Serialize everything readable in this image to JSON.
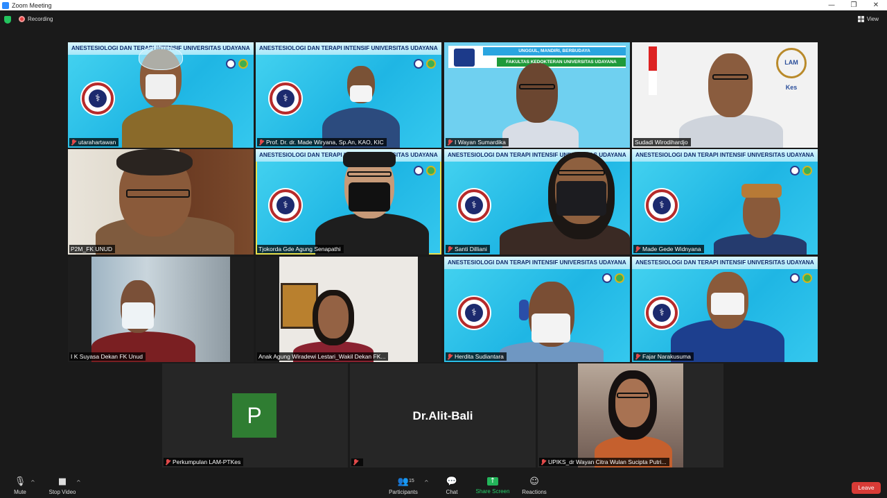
{
  "window": {
    "title": "Zoom Meeting",
    "minimize": "—",
    "restore": "❐",
    "close": "✕"
  },
  "topbar": {
    "recording": "Recording",
    "view": "View"
  },
  "banner_text": "ANESTESIOLOGI DAN TERAPI INTENSIF UNIVERSITAS UDAYANA",
  "slide3": {
    "line1": "UNGGUL, MANDIRI, BERBUDAYA",
    "line2": "FAKULTAS KEDOKTERAN UNIVERSITAS UDAYANA"
  },
  "lam_logo": "LAM Kes",
  "participants": [
    "utarahartawan",
    "Prof. Dr. dr. Made Wiryana, Sp.An, KAO, KIC",
    "I Wayan Sumardika",
    "Sudadi Wirodihardjo",
    "P2M_FK UNUD",
    "Tjokorda Gde Agung Senapathi",
    "Santi Dilliani",
    "Made Gede Widnyana",
    "I K Suyasa Dekan FK Unud",
    "Anak Agung Wiradewi Lestari_Wakil Dekan FK...",
    "Herdita Sudiantara",
    "Fajar Narakusuma",
    "Perkumpulan LAM-PTKes",
    "",
    "UPIKS_dr Wayan Citra Wulan Sucipta Putri..."
  ],
  "avatar_letter": "P",
  "big_name": "Dr.Alit-Bali",
  "toolbar": {
    "mute": "Mute",
    "stop_video": "Stop Video",
    "participants": "Participants",
    "participants_count": "15",
    "chat": "Chat",
    "share_screen": "Share Screen",
    "reactions": "Reactions",
    "leave": "Leave"
  },
  "colors": {
    "accent_green": "#23b55a",
    "leave_red": "#d83b36",
    "active_speaker": "#e9e04c"
  }
}
